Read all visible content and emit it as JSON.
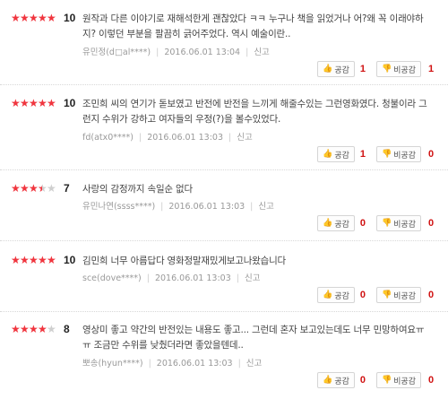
{
  "reviews": [
    {
      "rating": 10,
      "stars": [
        1,
        1,
        1,
        1,
        1
      ],
      "text": "원작과 다른 이야기로 재해석한게 괜찮았다 ㅋㅋ 누구나 책을 읽었거나 어?왜 꼭 이래야하지? 이렇던 부분을 팔끔히 긁어주었다. 역시 예술이란..",
      "author": "유민정(d□al****)",
      "date": "2016.06.01 13:04",
      "report": "신고",
      "like_label": "공감",
      "like_count": "1",
      "dislike_label": "비공감",
      "dislike_count": "1"
    },
    {
      "rating": 10,
      "stars": [
        1,
        1,
        1,
        1,
        1
      ],
      "text": "조민희 씨의 연기가 돋보였고 반전에 반전을 느끼게 해줄수있는 그런영화였다. 청불이라 그런지 수위가 강하고 여자들의 우정(?)을 볼수있었다.",
      "author": "fd(atx0****)",
      "date": "2016.06.01 13:03",
      "report": "신고",
      "like_label": "공감",
      "like_count": "1",
      "dislike_label": "비공감",
      "dislike_count": "0"
    },
    {
      "rating": 7,
      "stars": [
        1,
        1,
        1,
        0.5,
        0
      ],
      "text": "사랑의 감정까지 속일순 없다",
      "author": "유민나연(ssss****)",
      "date": "2016.06.01 13:03",
      "report": "신고",
      "like_label": "공감",
      "like_count": "0",
      "dislike_label": "비공감",
      "dislike_count": "0"
    },
    {
      "rating": 10,
      "stars": [
        1,
        1,
        1,
        1,
        1
      ],
      "text": "김민희 너무 아름답다 영화정말재밌게보고나왔습니다",
      "author": "sce(dove****)",
      "date": "2016.06.01 13:03",
      "report": "신고",
      "like_label": "공감",
      "like_count": "0",
      "dislike_label": "비공감",
      "dislike_count": "0"
    },
    {
      "rating": 8,
      "stars": [
        1,
        1,
        1,
        1,
        0
      ],
      "text": "영상미 좋고 약간의 반전있는 내용도 좋고... 그런데 혼자 보고있는데도 너무 민망하여요ㅠㅠ 조금만 수위를 낮췄더라면 좋았을텐데..",
      "author": "뽀송(hyun****)",
      "date": "2016.06.01 13:03",
      "report": "신고",
      "like_label": "공감",
      "like_count": "0",
      "dislike_label": "비공감",
      "dislike_count": "0"
    }
  ],
  "colors": {
    "star_on": "#f0353e",
    "star_off": "#cfcfcf",
    "count": "#d01212"
  },
  "icons": {
    "like": "thumbs-up-icon",
    "dislike": "thumbs-down-icon",
    "star": "star-icon"
  }
}
